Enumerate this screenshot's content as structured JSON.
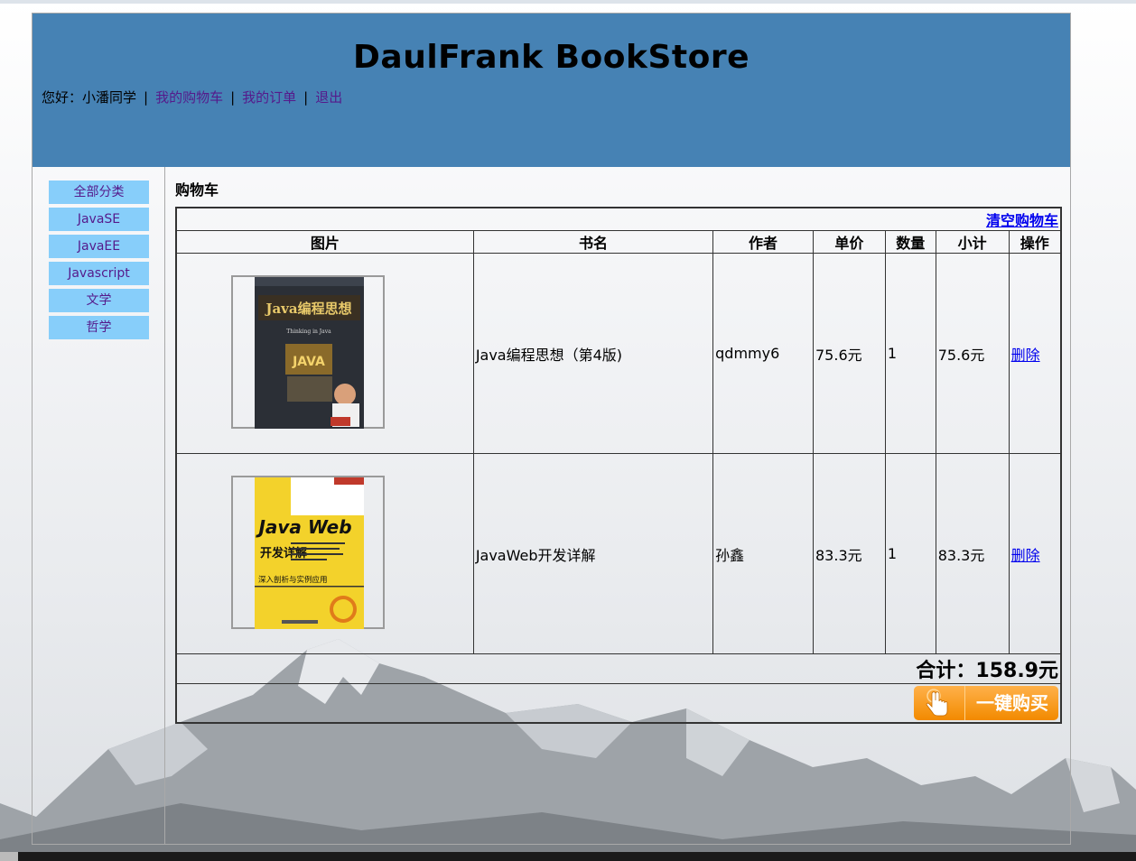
{
  "header": {
    "title": "DaulFrank BookStore",
    "greeting": "您好：小潘同学",
    "links": [
      "我的购物车",
      "我的订单",
      "退出"
    ]
  },
  "sidebar": {
    "categories": [
      "全部分类",
      "JavaSE",
      "JavaEE",
      "Javascript",
      "文学",
      "哲学"
    ]
  },
  "cart": {
    "heading": "购物车",
    "clear_label": "清空购物车",
    "columns": [
      "图片",
      "书名",
      "作者",
      "单价",
      "数量",
      "小计",
      "操作"
    ],
    "items": [
      {
        "cover_title": "Java编程思想",
        "cover_subtitle": "Thinking in Java",
        "name": "Java编程思想（第4版)",
        "author": "qdmmy6",
        "price": "75.6元",
        "qty": "1",
        "subtotal": "75.6元",
        "action": "删除"
      },
      {
        "cover_title": "Java Web",
        "cover_subtitle": "开发详解",
        "cover_caption": "深入剖析与实例应用",
        "name": "JavaWeb开发详解",
        "author": "孙鑫",
        "price": "83.3元",
        "qty": "1",
        "subtotal": "83.3元",
        "action": "删除"
      }
    ],
    "total": "合计：158.9元",
    "buy_label": "一键购买"
  },
  "icons": [
    "hand-pointer-icon"
  ],
  "colors": {
    "header_bg": "#4682b4",
    "category_bg": "#87cefa",
    "buy_button": "#f28a00"
  }
}
